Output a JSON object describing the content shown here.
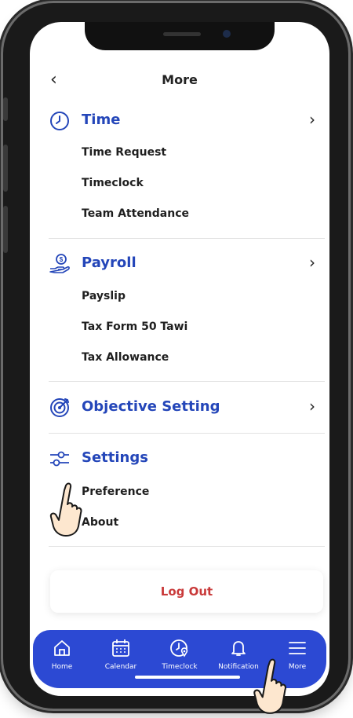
{
  "header": {
    "title": "More"
  },
  "sections": {
    "time": {
      "title": "Time",
      "items": [
        "Time Request",
        "Timeclock",
        "Team Attendance"
      ]
    },
    "payroll": {
      "title": "Payroll",
      "items": [
        "Payslip",
        "Tax Form 50 Tawi",
        "Tax Allowance"
      ]
    },
    "objective": {
      "title": "Objective Setting"
    },
    "settings": {
      "title": "Settings",
      "items": [
        "Preference",
        "About"
      ]
    }
  },
  "logout_label": "Log Out",
  "tabs": [
    "Home",
    "Calendar",
    "Timeclock",
    "Notification",
    "More"
  ],
  "colors": {
    "accent": "#2446b9",
    "tabbar": "#2c49d3",
    "logout": "#c93a3a"
  },
  "icons": [
    "back-chevron-icon",
    "clock-icon",
    "money-hand-icon",
    "target-icon",
    "sliders-icon",
    "home-icon",
    "calendar-icon",
    "timeclock-icon",
    "bell-icon",
    "menu-icon"
  ]
}
